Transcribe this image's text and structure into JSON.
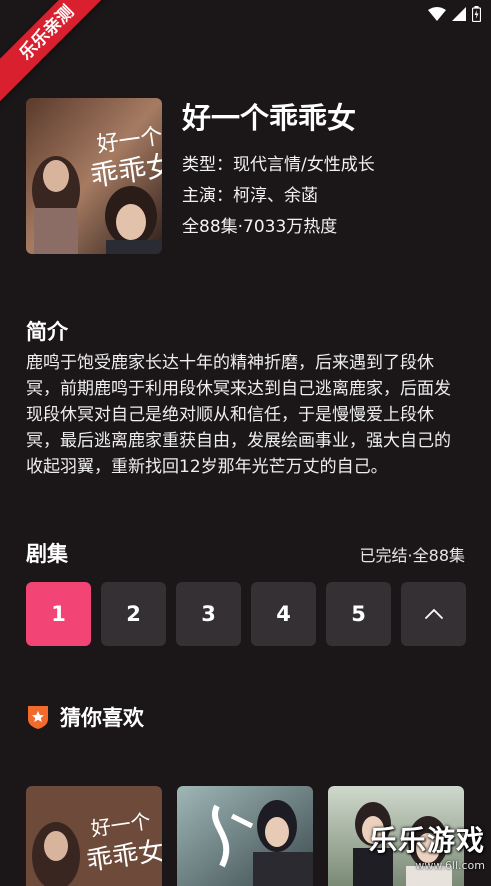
{
  "badge": "乐乐亲测",
  "drama": {
    "title": "好一个乖乖女",
    "type_line": "类型：现代言情/女性成长",
    "cast_line": "主演：柯淳、余菡",
    "stats_line": "全88集·7033万热度"
  },
  "intro": {
    "heading": "简介",
    "text": "鹿鸣于饱受鹿家长达十年的精神折磨，后来遇到了段休冥，前期鹿鸣于利用段休冥来达到自己逃离鹿家，后面发现段休冥对自己是绝对顺从和信任，于是慢慢爱上段休冥，最后逃离鹿家重获自由，发展绘画事业，强大自己的收起羽翼，重新找回12岁那年光芒万丈的自己。"
  },
  "episodes": {
    "heading": "剧集",
    "status": "已完结·全88集",
    "items": [
      "1",
      "2",
      "3",
      "4",
      "5"
    ],
    "active": "1"
  },
  "recommend": {
    "heading": "猜你喜欢"
  },
  "watermark": {
    "brand": "乐乐游戏",
    "url": "www.6ll.com"
  },
  "colors": {
    "background": "#1b1719",
    "accent": "#f24575",
    "tile": "#343034",
    "ribbon": "#d8202e"
  }
}
